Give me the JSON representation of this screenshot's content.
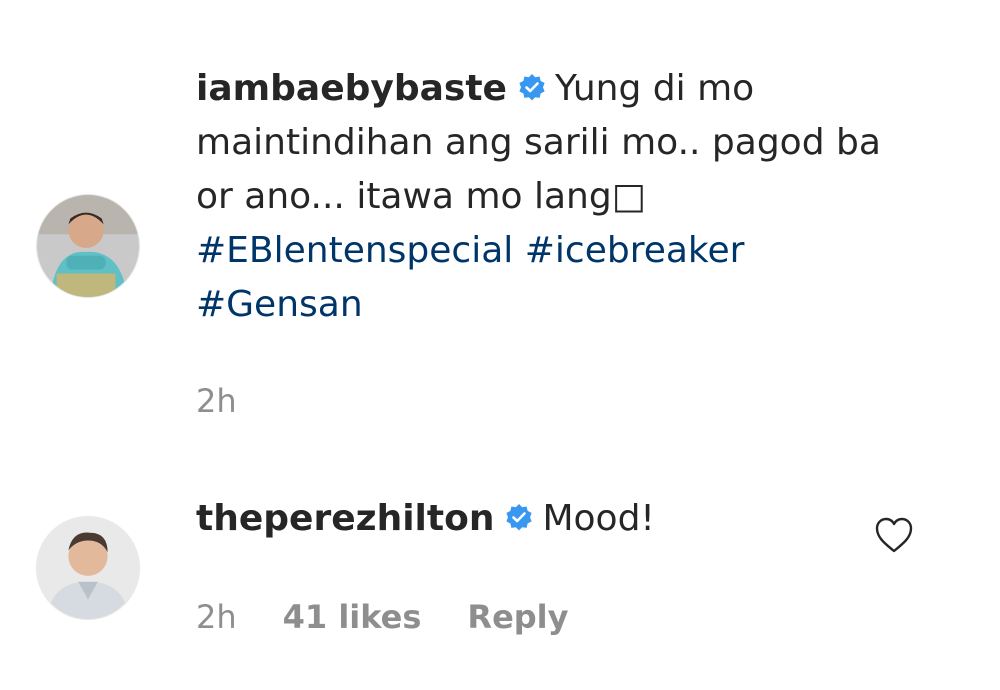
{
  "comments": [
    {
      "avatar_icon": "user-avatar-boy",
      "username": "iambaebybaste",
      "verified_icon": "verified-badge-icon",
      "caption_lines": [
        "Yung di mo",
        "maintindihan ang sarili mo.. pagod ba",
        "or ano... itawa mo lang□"
      ],
      "hashtags": [
        "#EBlentenspecial",
        "#icebreaker",
        "#Gensan"
      ],
      "time": "2h"
    },
    {
      "avatar_icon": "user-avatar-man",
      "username": "theperezhilton",
      "verified_icon": "verified-badge-icon",
      "text": "Mood!",
      "time": "2h",
      "likes": "41 likes",
      "reply_label": "Reply",
      "like_icon": "heart-icon"
    }
  ],
  "colors": {
    "text": "#262626",
    "muted": "#8e8e8e",
    "hashtag": "#003569",
    "verified": "#3897f0"
  }
}
